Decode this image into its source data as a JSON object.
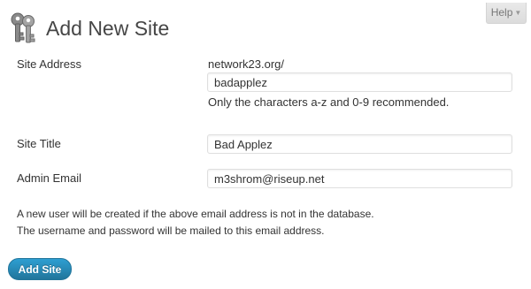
{
  "header": {
    "title": "Add New Site",
    "icon": "sites-keys-icon",
    "help_label": "Help",
    "help_arrow": "▼"
  },
  "form": {
    "site_address": {
      "label": "Site Address",
      "domain_suffix": "network23.org/",
      "value": "badapplez",
      "hint": "Only the characters a-z and 0-9 recommended."
    },
    "site_title": {
      "label": "Site Title",
      "value": "Bad Applez"
    },
    "admin_email": {
      "label": "Admin Email",
      "value": "m3shrom@riseup.net"
    },
    "notes": [
      "A new user will be created if the above email address is not in the database.",
      "The username and password will be mailed to this email address."
    ],
    "submit_label": "Add Site"
  },
  "colors": {
    "primary_button": "#21759b",
    "title_text": "#464646"
  }
}
